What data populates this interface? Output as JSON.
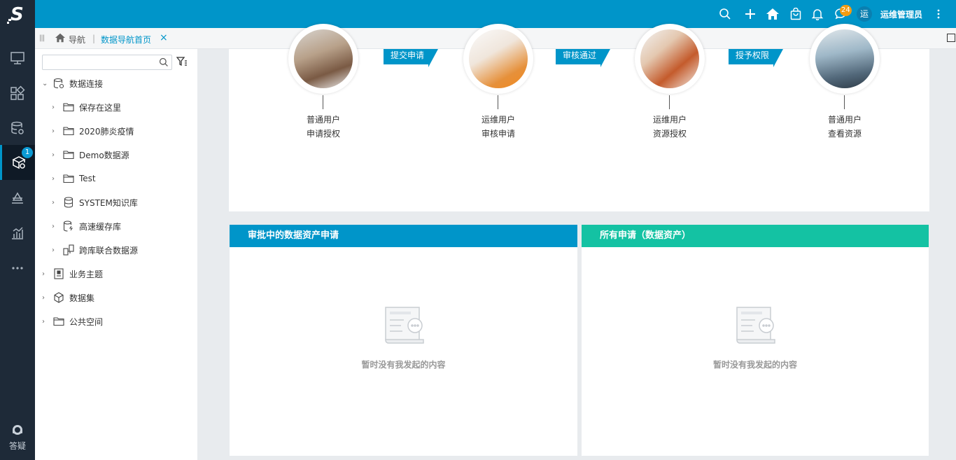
{
  "rail": {
    "logo": "S",
    "items": [
      {
        "icon": "monitor-icon"
      },
      {
        "icon": "widgets-icon"
      },
      {
        "icon": "database-settings-icon"
      },
      {
        "icon": "cube-share-icon",
        "badge": "1",
        "active": true
      },
      {
        "icon": "layers-icon"
      },
      {
        "icon": "bar-chart-icon"
      },
      {
        "icon": "more-icon"
      }
    ],
    "help_label": "答疑"
  },
  "topbar": {
    "message_count": "24",
    "avatar_text": "运",
    "user_name": "运维管理员",
    "accent": "#0095c9"
  },
  "tabbar": {
    "breadcrumb_root": "导航",
    "separator": "|",
    "active_tab": "数据导航首页",
    "close_glyph": "×"
  },
  "tree": {
    "search_placeholder": "",
    "nodes": [
      {
        "label": "数据连接",
        "expanded": true,
        "icon": "database-gear-icon"
      },
      {
        "label": "保存在这里",
        "icon": "folder-icon"
      },
      {
        "label": "2020肺炎疫情",
        "icon": "folder-icon"
      },
      {
        "label": "Demo数据源",
        "icon": "folder-icon"
      },
      {
        "label": "Test",
        "icon": "folder-icon"
      },
      {
        "label": "SYSTEM知识库",
        "icon": "database-icon"
      },
      {
        "label": "高速缓存库",
        "icon": "database-lightning-icon"
      },
      {
        "label": "跨库联合数据源",
        "icon": "federated-db-icon"
      },
      {
        "label": "业务主题",
        "icon": "theme-icon"
      },
      {
        "label": "数据集",
        "icon": "cube-icon"
      },
      {
        "label": "公共空间",
        "icon": "folder-icon"
      }
    ]
  },
  "flow": {
    "steps": [
      {
        "line1": "普通用户",
        "line2": "申请授权"
      },
      {
        "line1": "运维用户",
        "line2": "审核申请"
      },
      {
        "line1": "运维用户",
        "line2": "资源授权"
      },
      {
        "line1": "普通用户",
        "line2": "查看资源"
      }
    ],
    "arrows": [
      "提交申请",
      "审核通过",
      "授予权限"
    ]
  },
  "panels": [
    {
      "title": "审批中的数据资产申请",
      "color": "#0095c9",
      "empty_text": "暂时没有我发起的内容"
    },
    {
      "title": "所有申请（数据资产）",
      "color": "#14c2a3",
      "empty_text": "暂时没有我发起的内容"
    }
  ]
}
